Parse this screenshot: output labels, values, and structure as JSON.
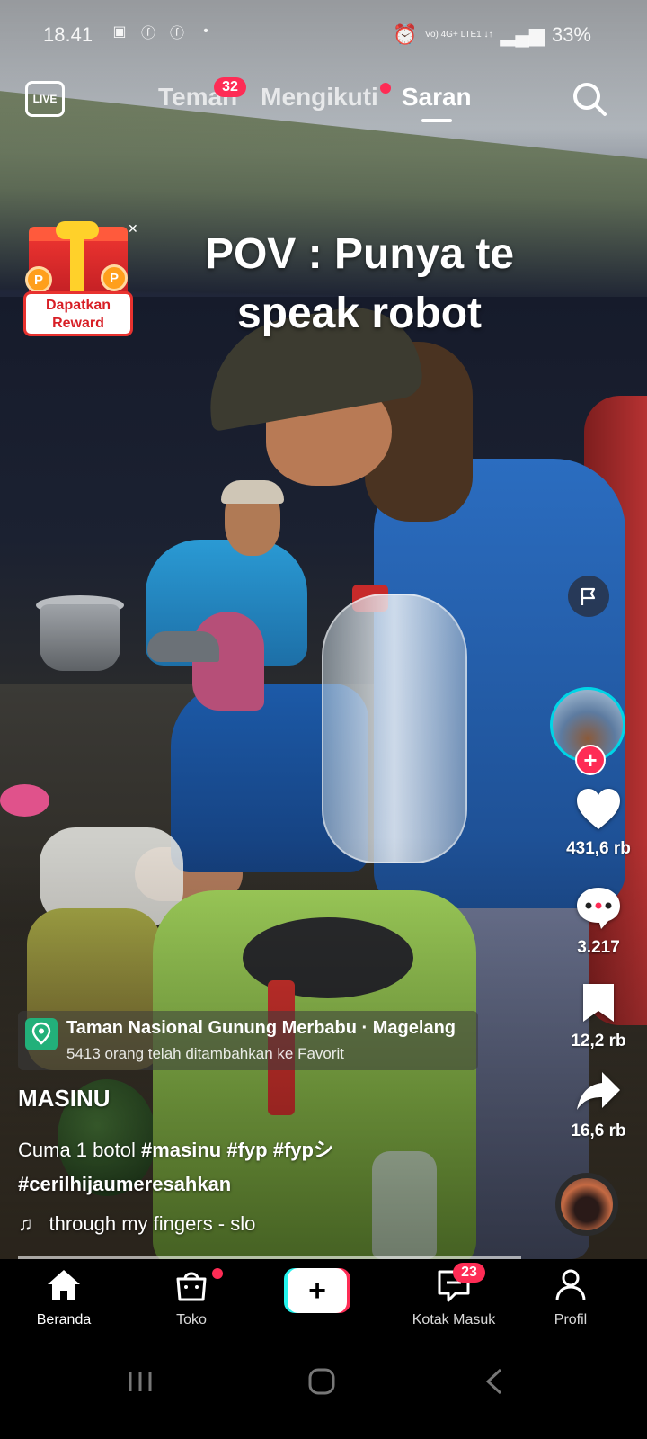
{
  "status_bar": {
    "time": "18.41",
    "network_label": "Vo) 4G+ LTE1 ↓↑",
    "battery": "33%"
  },
  "top_nav": {
    "live_label": "LIVE",
    "tabs": [
      {
        "label": "Teman",
        "badge": "32"
      },
      {
        "label": "Mengikuti"
      },
      {
        "label": "Saran",
        "active": true
      }
    ]
  },
  "video": {
    "caption_line1": "POV : Punya te",
    "caption_line2": "speak robot"
  },
  "reward": {
    "line1": "Dapatkan",
    "line2": "Reward"
  },
  "actions": {
    "likes": "431,6 rb",
    "comments": "3.217",
    "saves": "12,2 rb",
    "shares": "16,6 rb"
  },
  "location": {
    "title": "Taman Nasional Gunung Merbabu · Magelang",
    "subtitle": "5413 orang telah ditambahkan ke Favorit"
  },
  "post": {
    "username": "MASINU",
    "text": "Cuma 1 botol",
    "tags": [
      "#masinu",
      "#fyp",
      "#fypシ",
      "#cerilhijaumeresahkan"
    ],
    "sound": "through my fingers - slo"
  },
  "tab_bar": {
    "items": [
      {
        "label": "Beranda",
        "icon": "home-icon",
        "active": true
      },
      {
        "label": "Toko",
        "icon": "shop-icon"
      },
      {
        "label": "",
        "icon": "create-icon"
      },
      {
        "label": "Kotak Masuk",
        "icon": "inbox-icon",
        "badge": "23"
      },
      {
        "label": "Profil",
        "icon": "profile-icon"
      }
    ]
  },
  "colors": {
    "accent": "#fe2c55",
    "cyan": "#25f4ee",
    "location_green": "#22b07a"
  }
}
